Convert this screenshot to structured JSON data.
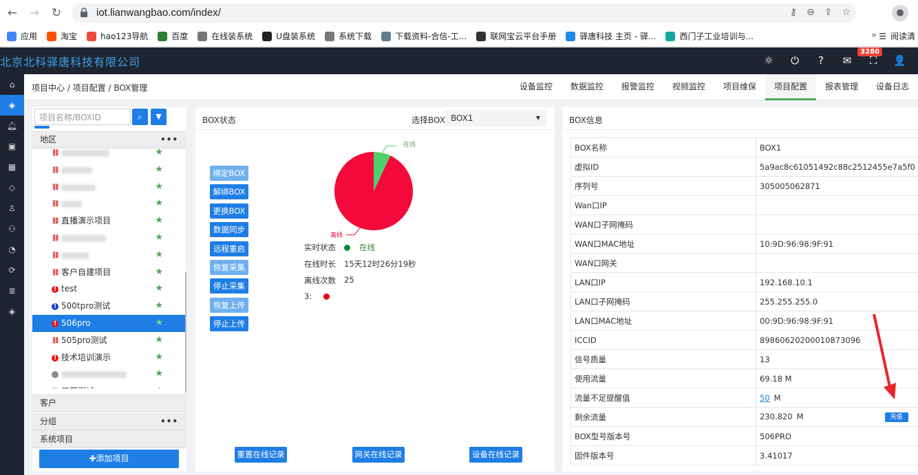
{
  "browser": {
    "url": "iot.lianwangbao.com/index/",
    "bookmarks": [
      "应用",
      "淘宝",
      "hao123导航",
      "百度",
      "在线装系统",
      "U盘装系统",
      "系统下载",
      "下载资料-合信-工...",
      "联网宝云平台手册",
      "驿唐科技 主页 - 驿...",
      "西门子工业培训与..."
    ],
    "bookmarks_more": "»",
    "reading_list": "阅读清"
  },
  "header": {
    "company": "北京北科驿唐科技有限公司",
    "badge_count": "3280"
  },
  "breadcrumb": "项目中心 / 项目配置 / BOX管理",
  "tabs": [
    "设备监控",
    "数据监控",
    "报警监控",
    "视频监控",
    "项目维保",
    "项目配置",
    "报表管理",
    "设备日志"
  ],
  "active_tab": "项目配置",
  "tree": {
    "search_placeholder": "项目名称/BOXID",
    "sections": {
      "region": "地区",
      "customer": "客户",
      "group": "分组",
      "system": "系统项目"
    },
    "items": [
      {
        "label": "",
        "icon": "link-red",
        "blur": 70
      },
      {
        "label": "",
        "icon": "link-red",
        "blur": 45
      },
      {
        "label": "",
        "icon": "link-red",
        "blur": 50
      },
      {
        "label": "",
        "icon": "link-red",
        "blur": 30
      },
      {
        "label": "直播演示项目",
        "icon": "link-red"
      },
      {
        "label": "",
        "icon": "link-red",
        "blur": 65
      },
      {
        "label": "",
        "icon": "link-red",
        "blur": 40
      },
      {
        "label": "客户自建项目",
        "icon": "link-red"
      },
      {
        "label": "test",
        "icon": "alert-red"
      },
      {
        "label": "500tpro测试",
        "icon": "alert-blue"
      },
      {
        "label": "506pro",
        "icon": "alert-red",
        "selected": true
      },
      {
        "label": "505pro测试",
        "icon": "link-red"
      },
      {
        "label": "技术培训演示",
        "icon": "alert-red"
      },
      {
        "label": "",
        "icon": "dot-gray",
        "blur": 95
      },
      {
        "label": "三菱测试",
        "icon": "link-red"
      }
    ],
    "add_button": "✚添加项目"
  },
  "status": {
    "title": "BOX状态",
    "select_label": "选择BOX",
    "selected_box": "BOX1",
    "actions": [
      {
        "label": "绑定BOX",
        "disabled": true
      },
      {
        "label": "解绑BOX",
        "disabled": false
      },
      {
        "label": "更换BOX",
        "disabled": false
      },
      {
        "label": "数据同步",
        "disabled": false
      },
      {
        "label": "远程重启",
        "disabled": false
      },
      {
        "label": "恢复采集",
        "disabled": true
      },
      {
        "label": "停止采集",
        "disabled": false
      },
      {
        "label": "恢复上传",
        "disabled": true
      },
      {
        "label": "停止上传",
        "disabled": false
      }
    ],
    "pie_online_label": "在线",
    "pie_offline_label": "离线",
    "pie_online_fraction": 0.07,
    "realtime_label": "实时状态",
    "realtime_value": "在线",
    "online_time_label": "在线时长",
    "online_time_value": "15天12时26分19秒",
    "offline_count_label": "离线次数",
    "offline_count_value": "25",
    "extra_label": "3:",
    "records": [
      "重置在线记录",
      "网关在线记录",
      "设备在线记录"
    ],
    "colors": {
      "online": "#4cd06a",
      "offline": "#f5093b"
    }
  },
  "info": {
    "title": "BOX信息",
    "rows": [
      {
        "key": "BOX名称",
        "value": "BOX1"
      },
      {
        "key": "虚拟ID",
        "value": "5a9ac8c61051492c88c2512455e7a5f0"
      },
      {
        "key": "序列号",
        "value": "305005062871"
      },
      {
        "key": "Wan口IP",
        "value": ""
      },
      {
        "key": "WAN口子网掩码",
        "value": ""
      },
      {
        "key": "WAN口MAC地址",
        "value": "10:9D:96:98:9F:91"
      },
      {
        "key": "WAN口网关",
        "value": ""
      },
      {
        "key": "LAN口IP",
        "value": "192.168.10.1"
      },
      {
        "key": "LAN口子网掩码",
        "value": "255.255.255.0"
      },
      {
        "key": "LAN口MAC地址",
        "value": "00:9D:96:98:9F:91"
      },
      {
        "key": "ICCID",
        "value": "89860620200010873096"
      },
      {
        "key": "信号质量",
        "value": "13"
      },
      {
        "key": "使用流量",
        "value": "69.18 M"
      },
      {
        "key": "流量不足提醒值",
        "value": "50",
        "unit": "M",
        "warn": true
      },
      {
        "key": "剩余流量",
        "value": "230.820",
        "unit": "M",
        "recharge": "充值"
      },
      {
        "key": "BOX型号版本号",
        "value": "506PRO"
      },
      {
        "key": "固件版本号",
        "value": "3.41017"
      }
    ]
  }
}
